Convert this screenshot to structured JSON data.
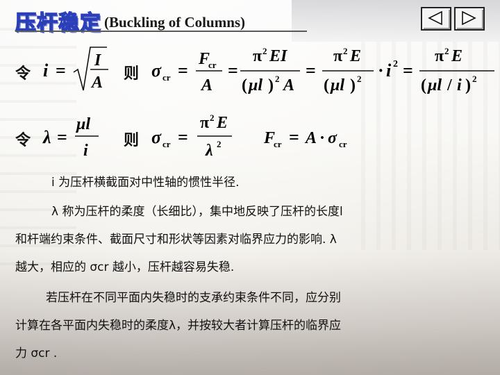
{
  "slide": {
    "title_cn": "压杆稳定",
    "title_en": "(Buckling of Columns)"
  },
  "nav": {
    "prev_label": "previous slide",
    "next_label": "next slide"
  },
  "formulas": {
    "let_1": "令",
    "then_1": "则",
    "let_2": "令",
    "then_2": "则"
  },
  "paragraphs": {
    "p1": "i 为压杆横截面对中性轴的惯性半径.",
    "p2_line1": "λ 称为压杆的柔度（长细比），集中地反映了压杆的长度l",
    "p2_line2": "和杆端约束条件、截面尺寸和形状等因素对临界应力的影响. λ",
    "p2_line3": "越大，相应的 σcr 越小，压杆越容易失稳.",
    "p3_line1": "若压杆在不同平面内失稳时的支承约束条件不同，应分别",
    "p3_line2": "计算在各平面内失稳时的柔度λ，并按较大者计算压杆的临界应",
    "p3_line3": "力 σcr ."
  },
  "colors": {
    "title_outline": "#2a3fb8",
    "text": "#111111"
  }
}
